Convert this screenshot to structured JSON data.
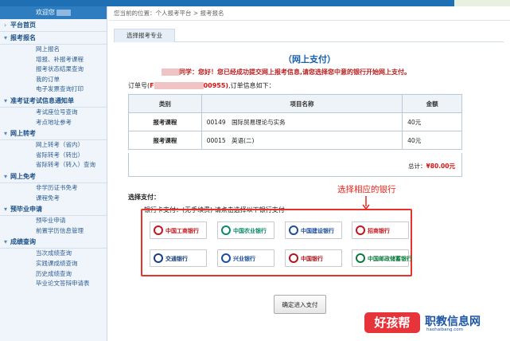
{
  "sidebar": {
    "welcome": "欢迎您",
    "sections": [
      {
        "label": "平台首页",
        "arrow": "›",
        "items": []
      },
      {
        "label": "报考报名",
        "arrow": "▾",
        "items": [
          "网上报名",
          "增报、补报考课程",
          "报考状态结果查询",
          "我的订单",
          "电子发票查询打印"
        ]
      },
      {
        "label": "准考证考试信息通知单",
        "arrow": "▾",
        "items": [
          "考试座位号查询",
          "考点地址参考"
        ]
      },
      {
        "label": "网上转考",
        "arrow": "▾",
        "items": [
          "网上转考（省内）",
          "省际转考（转出）",
          "省际转考（转入）查询"
        ]
      },
      {
        "label": "网上免考",
        "arrow": "▾",
        "items": [
          "非学历证书免考",
          "课程免考"
        ]
      },
      {
        "label": "预毕业申请",
        "arrow": "▾",
        "items": [
          "预毕业申请",
          "前置学历信息管理"
        ]
      },
      {
        "label": "成绩查询",
        "arrow": "▾",
        "items": [
          "当次成绩查询",
          "实践课成绩查询",
          "历史成绩查询",
          "毕业论文答辩申请表"
        ]
      }
    ]
  },
  "breadcrumb": "您当前的位置：个人报考平台 > 报考报名",
  "tab": "选择报考专业",
  "payment": {
    "title": "（网上支付）",
    "greeting": "同学：您好！您已经成功提交网上报考信息,请您选择您中意的银行开始网上支付。",
    "order_prefix": "订单号(",
    "order_f": "F",
    "order_tail": "00955)",
    "order_suffix": ",订单信息如下：",
    "columns": [
      "类别",
      "项目名称",
      "金额"
    ],
    "rows": [
      {
        "type": "报考课程",
        "name": "00149　国际贸易理论与实务",
        "amount": "40元"
      },
      {
        "type": "报考课程",
        "name": "00015　英语(二)",
        "amount": "40元"
      }
    ],
    "total_label": "总计：",
    "total_value": "¥80.00元",
    "select_label": "选择支付：",
    "card_label": "银行卡支付：(无手续费) 请点击选择以下银行支付",
    "hint": "选择相应的银行",
    "confirm": "确定进入支付"
  },
  "banks": [
    {
      "name": "中国工商银行",
      "icon": "icbc-icon",
      "color": "#c8161d"
    },
    {
      "name": "中国农业银行",
      "icon": "abc-icon",
      "color": "#0a8a6a"
    },
    {
      "name": "中国建设银行",
      "icon": "ccb-icon",
      "color": "#1b4ea2"
    },
    {
      "name": "招商银行",
      "icon": "cmb-icon",
      "color": "#c8161d"
    },
    {
      "name": "交通银行",
      "icon": "bocom-icon",
      "color": "#16407e"
    },
    {
      "name": "兴业银行",
      "icon": "cib-icon",
      "color": "#1b4ea2"
    },
    {
      "name": "中国银行",
      "icon": "boc-icon",
      "color": "#b2151b"
    },
    {
      "name": "中国邮政储蓄银行",
      "icon": "psbc-icon",
      "color": "#0a7a3c"
    }
  ],
  "watermark": {
    "brand": "好孩帮",
    "title": "职教信息网",
    "url": "haohaibang.com"
  },
  "colors": {
    "accent": "#2f7dc1",
    "highlight": "#e8332a",
    "amount": "#dd1111"
  }
}
